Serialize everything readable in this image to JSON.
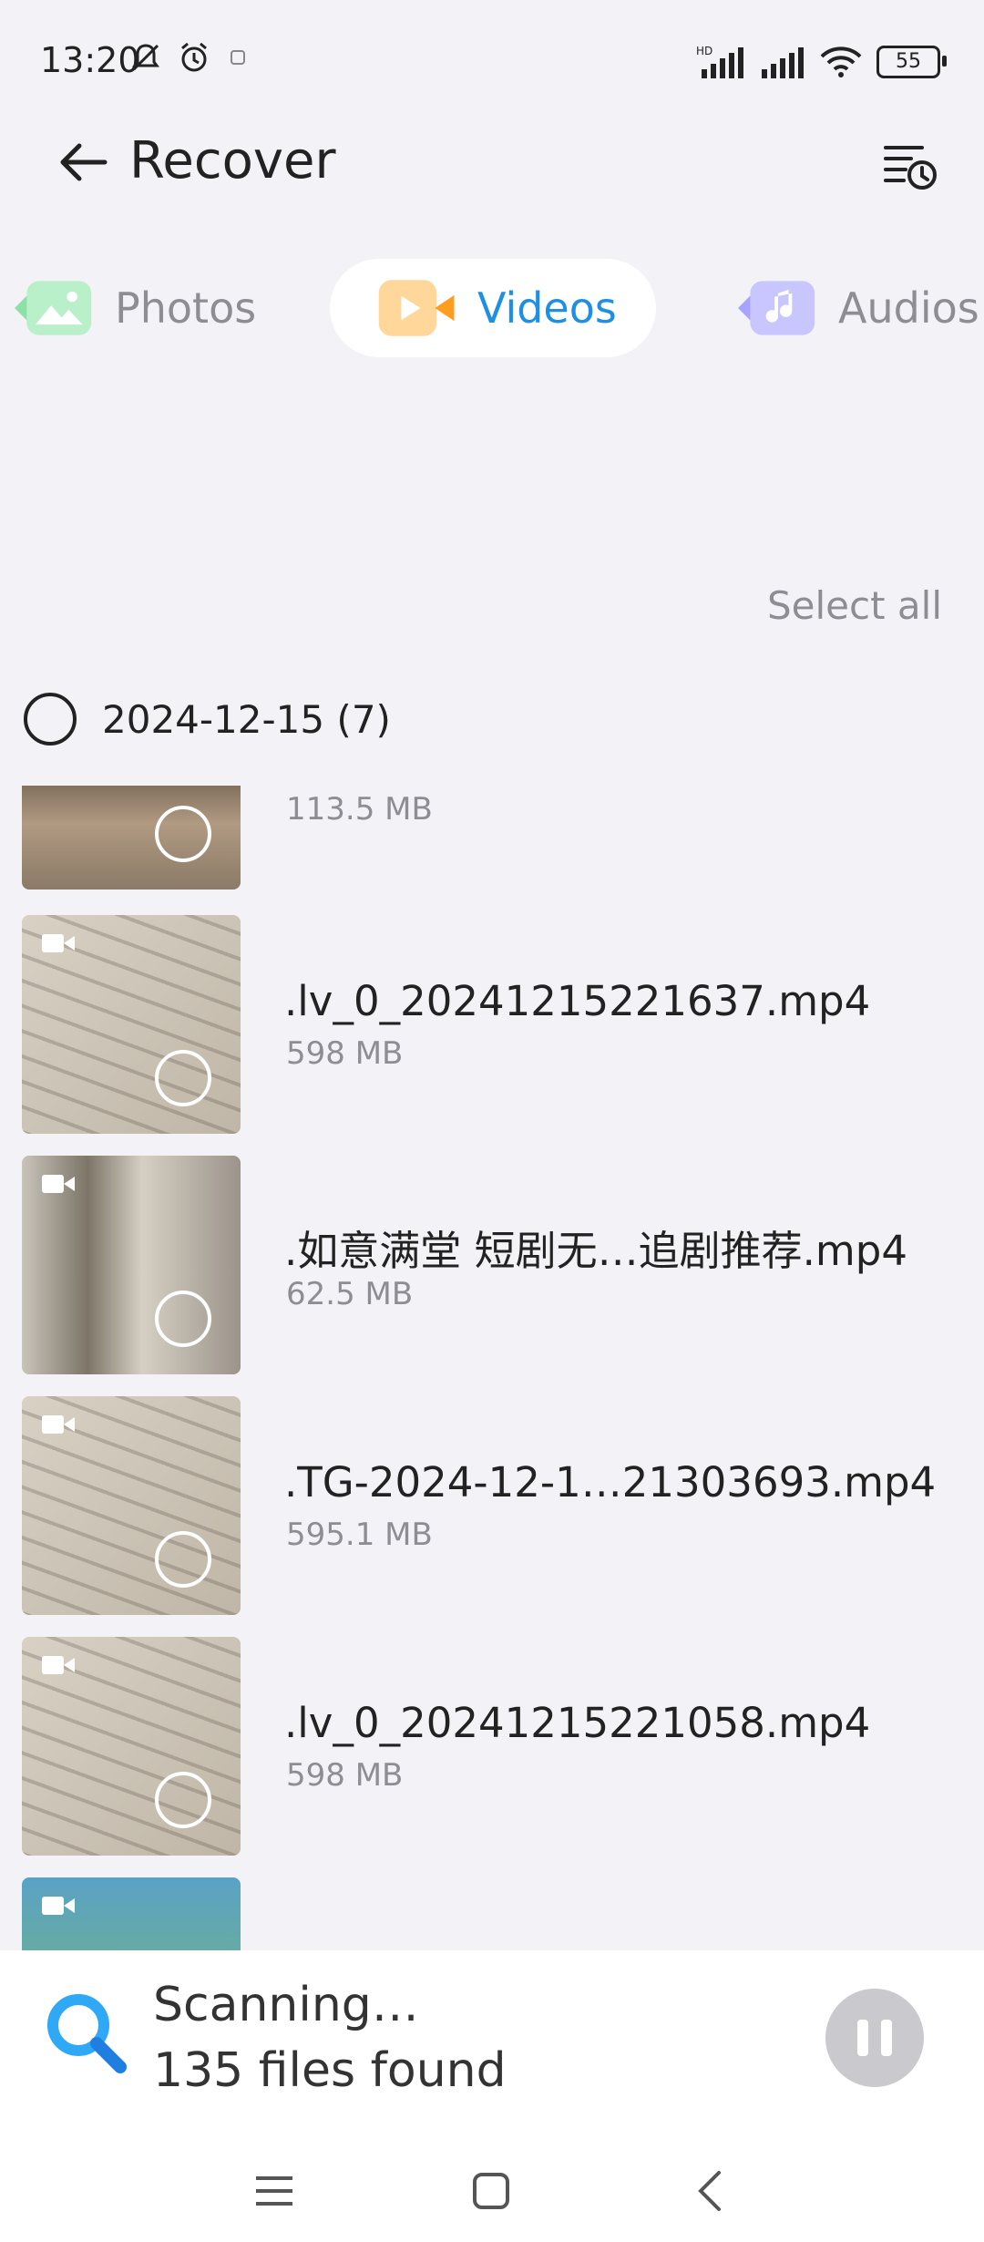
{
  "status_bar": {
    "time": "13:20",
    "network_label": "HD",
    "battery": "55"
  },
  "header": {
    "title": "Recover",
    "icons": [
      "back-arrow-icon",
      "history-clock-icon"
    ]
  },
  "tabs": [
    {
      "label": "Photos",
      "icon": "photos-icon",
      "selected": false
    },
    {
      "label": "Videos",
      "icon": "videos-icon",
      "selected": true
    },
    {
      "label": "Audios",
      "icon": "audios-icon",
      "selected": false
    }
  ],
  "select_all_label": "Select all",
  "date_group": {
    "label": "2024-12-15 (7)"
  },
  "files": [
    {
      "name": "",
      "size": "113.5 MB"
    },
    {
      "name": ".lv_0_20241215221637.mp4",
      "size": "598 MB"
    },
    {
      "name": ".如意满堂 短剧无…追剧推荐.mp4",
      "size": "62.5 MB"
    },
    {
      "name": ".TG-2024-12-1…21303693.mp4",
      "size": "595.1 MB"
    },
    {
      "name": ".lv_0_20241215221058.mp4",
      "size": "598 MB"
    },
    {
      "name": "",
      "size": ""
    }
  ],
  "scan": {
    "title": "Scanning…",
    "count": "135 files found"
  },
  "colors": {
    "accent": "#1f8fe3",
    "background": "#f2f2f7"
  }
}
